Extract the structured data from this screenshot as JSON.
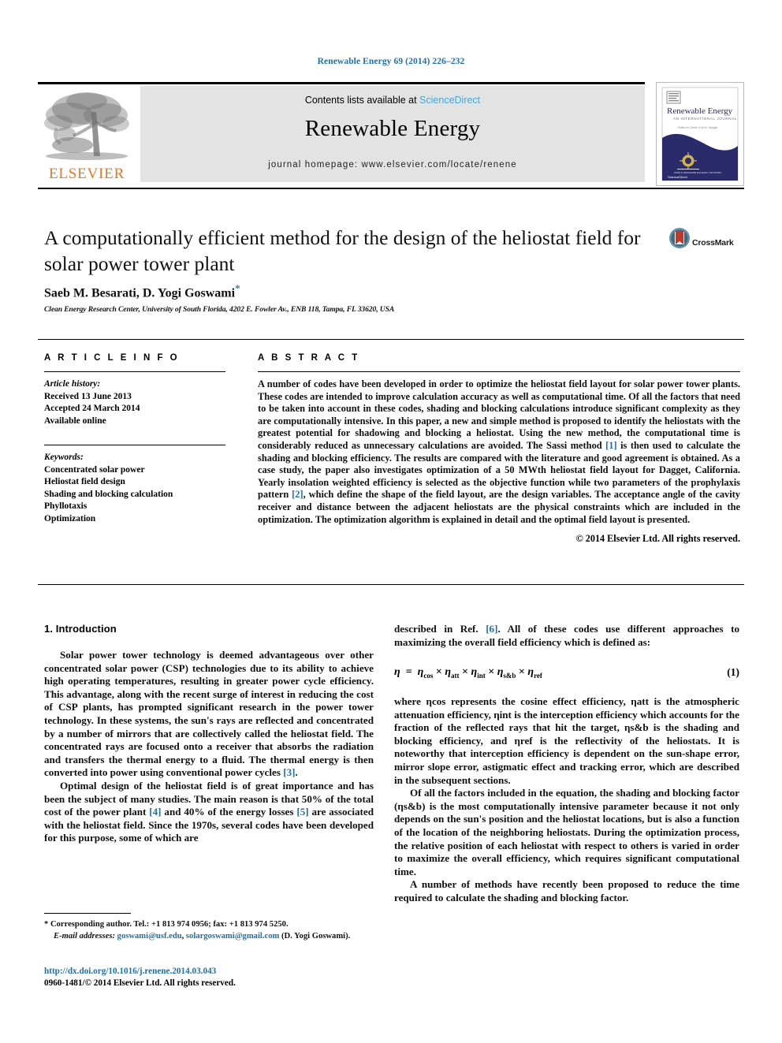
{
  "running_head": "Renewable Energy 69 (2014) 226–232",
  "masthead": {
    "publisher_name": "ELSEVIER",
    "contents_prefix": "Contents lists available at ",
    "contents_link": "ScienceDirect",
    "journal_title": "Renewable Energy",
    "homepage": "journal homepage: www.elsevier.com/locate/renene",
    "cover": {
      "title": "Renewable Energy",
      "subtitle": "AN INTERNATIONAL JOURNAL",
      "editor_line": "Editor-in-Chief: A.A.M. Sayigh"
    }
  },
  "article": {
    "title": "A computationally efficient method for the design of the heliostat field for solar power tower plant",
    "authors": "Saeb M. Besarati, D. Yogi Goswami",
    "corresponding_marker": "*",
    "affiliation": "Clean Energy Research Center, University of South Florida, 4202 E. Fowler Av., ENB 118, Tampa, FL 33620, USA",
    "crossmark_label": "CrossMark"
  },
  "article_info": {
    "heading": "A R T I C L E   I N F O",
    "history_label": "Article history:",
    "history": [
      "Received 13 June 2013",
      "Accepted 24 March 2014",
      "Available online"
    ],
    "keywords_label": "Keywords:",
    "keywords": [
      "Concentrated solar power",
      "Heliostat field design",
      "Shading and blocking calculation",
      "Phyllotaxis",
      "Optimization"
    ]
  },
  "abstract": {
    "heading": "A B S T R A C T",
    "paragraph_part1": "A number of codes have been developed in order to optimize the heliostat field layout for solar power tower plants. These codes are intended to improve calculation accuracy as well as computational time. Of all the factors that need to be taken into account in these codes, shading and blocking calculations introduce significant complexity as they are computationally intensive. In this paper, a new and simple method is proposed to identify the heliostats with the greatest potential for shadowing and blocking a heliostat. Using the new method, the computational time is considerably reduced as unnecessary calculations are avoided. The Sassi method ",
    "ref1": "[1]",
    "paragraph_part2": " is then used to calculate the shading and blocking efficiency. The results are compared with the literature and good agreement is obtained. As a case study, the paper also investigates optimization of a 50 MWth heliostat field layout for Dagget, California. Yearly insolation weighted efficiency is selected as the objective function while two parameters of the prophylaxis pattern ",
    "ref2": "[2]",
    "paragraph_part3": ", which define the shape of the field layout, are the design variables. The acceptance angle of the cavity receiver and distance between the adjacent heliostats are the physical constraints which are included in the optimization. The optimization algorithm is explained in detail and the optimal field layout is presented.",
    "copyright": "© 2014 Elsevier Ltd. All rights reserved."
  },
  "introduction": {
    "heading": "1. Introduction",
    "left_p1_a": "Solar power tower technology is deemed advantageous over other concentrated solar power (CSP) technologies due to its ability to achieve high operating temperatures, resulting in greater power cycle efficiency. This advantage, along with the recent surge of interest in reducing the cost of CSP plants, has prompted significant research in the power tower technology. In these systems, the sun's rays are reflected and concentrated by a number of mirrors that are collectively called the heliostat field. The concentrated rays are focused onto a receiver that absorbs the radiation and transfers the thermal energy to a fluid. The thermal energy is then converted into power using conventional power cycles ",
    "left_p1_ref": "[3]",
    "left_p1_b": ".",
    "left_p2_a": "Optimal design of the heliostat field is of great importance and has been the subject of many studies. The main reason is that 50% of the total cost of the power plant ",
    "left_p2_ref4": "[4]",
    "left_p2_b": " and 40% of the energy losses ",
    "left_p2_ref5": "[5]",
    "left_p2_c": " are associated with the heliostat field. Since the 1970s, several codes have been developed for this purpose, some of which are",
    "right_p1_a": "described in Ref. ",
    "right_p1_ref": "[6]",
    "right_p1_b": ". All of these codes use different approaches to maximizing the overall field efficiency which is defined as:",
    "equation_number": "(1)",
    "equation_text": "η = ηcos × ηatt × ηint × ηs&b × ηref",
    "right_p2": "where ηcos represents the cosine effect efficiency, ηatt is the atmospheric attenuation efficiency, ηint is the interception efficiency which accounts for the fraction of the reflected rays that hit the target, ηs&b is the shading and blocking efficiency, and ηref is the reflectivity of the heliostats. It is noteworthy that interception efficiency is dependent on the sun-shape error, mirror slope error, astigmatic effect and tracking error, which are described in the subsequent sections.",
    "right_p3": "Of all the factors included in the equation, the shading and blocking factor (ηs&b) is the most computationally intensive parameter because it not only depends on the sun's position and the heliostat locations, but is also a function of the location of the neighboring heliostats. During the optimization process, the relative position of each heliostat with respect to others is varied in order to maximize the overall efficiency, which requires significant computational time.",
    "right_p4": "A number of methods have recently been proposed to reduce the time required to calculate the shading and blocking factor."
  },
  "footer": {
    "corresponding_marker": "*",
    "corresponding_text": " Corresponding author. Tel.: +1 813 974 0956; fax: +1 813 974 5250.",
    "email_label": "E-mail addresses:",
    "email1": "goswami@usf.edu",
    "email_sep": ", ",
    "email2": "solargoswami@gmail.com",
    "email_suffix": " (D. Yogi Goswami).",
    "doi": "http://dx.doi.org/10.1016/j.renene.2014.03.043",
    "issn_line": "0960-1481/© 2014 Elsevier Ltd. All rights reserved."
  },
  "colors": {
    "link_blue": "#1f6fa8",
    "sciencedirect_blue": "#3fa9dd",
    "elsevier_orange": "#E87722",
    "cover_navy": "#2b2b6b",
    "crossmark_red": "#c0392b"
  }
}
